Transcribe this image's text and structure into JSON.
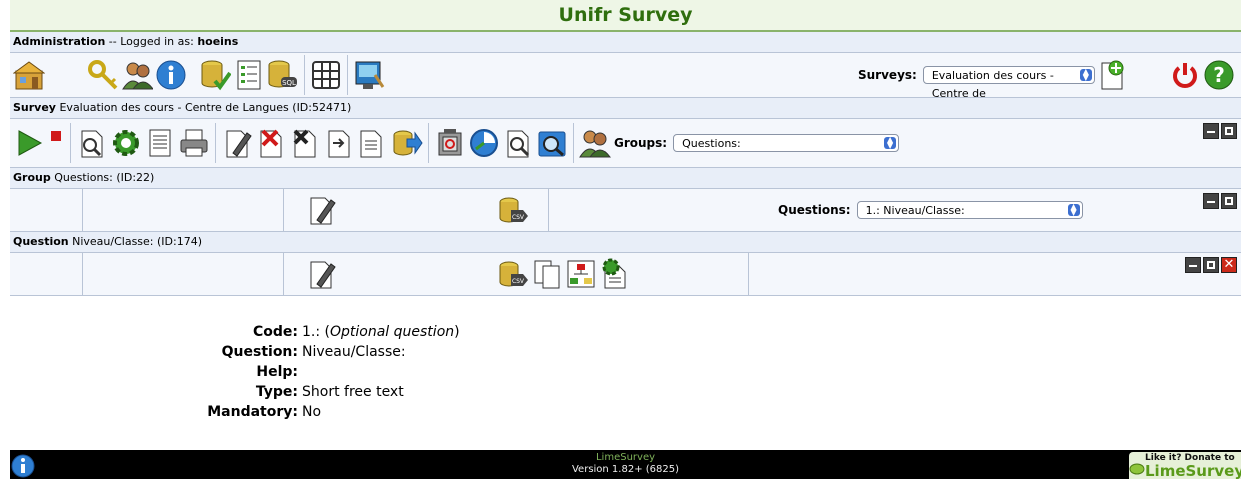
{
  "title": "Unifr Survey",
  "admin": {
    "section_label": "Administration",
    "logged_in_text": " -- Logged in as: ",
    "username": "hoeins",
    "surveys_label": "Surveys:",
    "surveys_selected": "Evaluation des cours - Centre de"
  },
  "survey": {
    "section_label": "Survey",
    "name": " Evaluation des cours - Centre de Langues (ID:52471)",
    "groups_label": "Groups:",
    "groups_selected": "Questions:"
  },
  "group": {
    "section_label": "Group",
    "name": " Questions: (ID:22)",
    "questions_label": "Questions:",
    "questions_selected": "1.: Niveau/Classe:"
  },
  "question": {
    "section_label": "Question",
    "name": " Niveau/Classe: (ID:174)"
  },
  "details": {
    "code_label": "Code:",
    "code_value": "1.: ",
    "code_optional": "Optional question",
    "question_label": "Question:",
    "question_value": "Niveau/Classe:",
    "help_label": "Help:",
    "type_label": "Type:",
    "type_value": "Short free text",
    "mandatory_label": "Mandatory:",
    "mandatory_value": "No"
  },
  "footer": {
    "app_name": "LimeSurvey",
    "version": "Version 1.82+ (6825)",
    "donate_small": "Like it? Donate to",
    "donate_big": "LimeSurvey"
  },
  "colors": {
    "title": "#2f6e0e",
    "accent_green": "#7fb25a",
    "close_red": "#cc2a1a"
  }
}
